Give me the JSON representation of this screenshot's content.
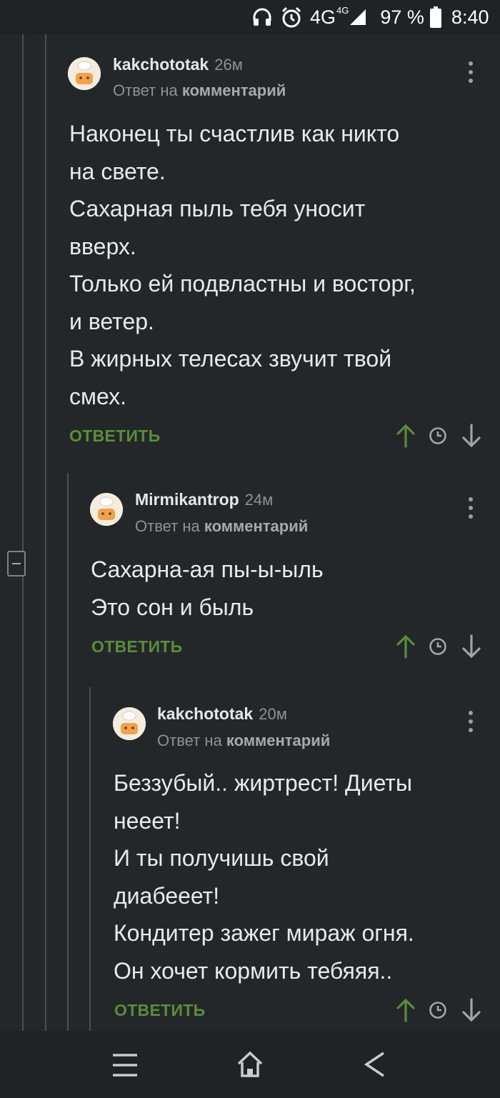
{
  "status_bar": {
    "network": "4G",
    "network_sup": "4G",
    "battery": "97 %",
    "time": "8:40",
    "icons": [
      "headphones-icon",
      "alarm-icon",
      "signal-icon",
      "battery-icon"
    ]
  },
  "colors": {
    "background": "#23272a",
    "accent_green": "#5b8c3a",
    "muted_text": "#8d9297"
  },
  "comments": [
    {
      "author": "kakchototak",
      "time": "26м",
      "reply_prefix": "Ответ на",
      "reply_target": "комментарий",
      "lines": [
        "Наконец ты счастлив как никто",
        "на свете.",
        "Сахарная пыль тебя уносит",
        "вверх.",
        "Только ей подвластны и восторг,",
        "и ветер.",
        "В жирных телесах звучит твой",
        "смех."
      ],
      "reply_label": "ОТВЕТИТЬ"
    },
    {
      "author": "Mirmikantrop",
      "time": "24м",
      "reply_prefix": "Ответ на",
      "reply_target": "комментарий",
      "lines": [
        "Сахарна-ая пы-ы-ыль",
        "Это сон и быль"
      ],
      "reply_label": "ОТВЕТИТЬ"
    },
    {
      "author": "kakchototak",
      "time": "20м",
      "reply_prefix": "Ответ на",
      "reply_target": "комментарий",
      "lines": [
        "Беззубый.. жиртрест! Диеты",
        "нееет!",
        "И ты получишь свой",
        "диабееет!",
        "Кондитер зажег мираж огня.",
        "Он хочет кормить тебяяя.."
      ],
      "reply_label": "ОТВЕТИТЬ"
    }
  ],
  "nav_bar": {
    "icons": [
      "menu-icon",
      "home-icon",
      "back-icon"
    ]
  }
}
